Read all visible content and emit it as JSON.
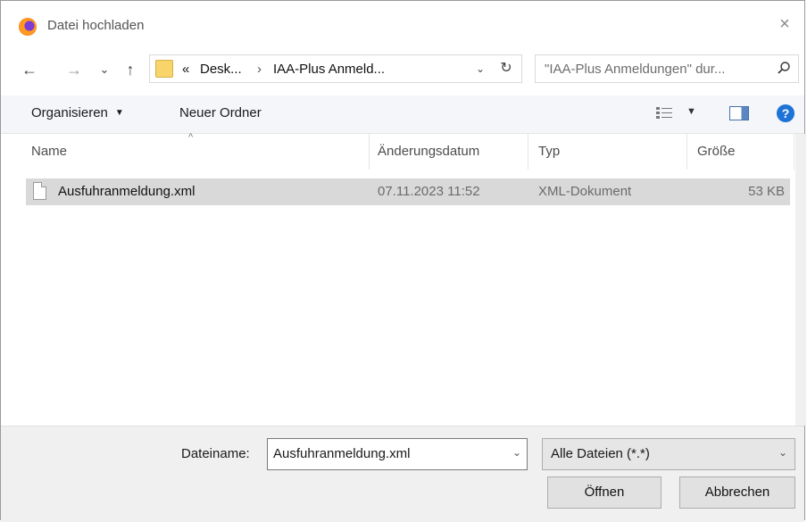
{
  "window": {
    "title": "Datei hochladen",
    "close_glyph": "×"
  },
  "nav": {
    "back_glyph": "←",
    "forward_glyph": "→",
    "recent_glyph": "⌄",
    "up_glyph": "↑",
    "breadcrumb_prefix": "«",
    "breadcrumb_1": "Desk...",
    "breadcrumb_sep": "›",
    "breadcrumb_2": "IAA-Plus Anmeld...",
    "dropdown_glyph": "⌄",
    "refresh_glyph": "↻",
    "search_placeholder": "\"IAA-Plus Anmeldungen\" dur..."
  },
  "toolbar": {
    "organize_label": "Organisieren",
    "organize_caret": "▼",
    "new_folder_label": "Neuer Ordner",
    "view_caret": "▼",
    "help_glyph": "?"
  },
  "columns": {
    "sort_glyph": "^",
    "name": "Name",
    "date": "Änderungsdatum",
    "type": "Typ",
    "size": "Größe"
  },
  "files": [
    {
      "name": "Ausfuhranmeldung.xml",
      "date": "07.11.2023 11:52",
      "type": "XML-Dokument",
      "size": "53 KB"
    }
  ],
  "footer": {
    "filename_label": "Dateiname:",
    "filename_value": "Ausfuhranmeldung.xml",
    "filetype_value": "Alle Dateien (*.*)",
    "dropdown_glyph": "⌄",
    "open_label": "Öffnen",
    "cancel_label": "Abbrechen"
  },
  "colors": {
    "accent": "#1e73d6",
    "selection": "#d9d9d9",
    "folder": "#f7d56b"
  }
}
